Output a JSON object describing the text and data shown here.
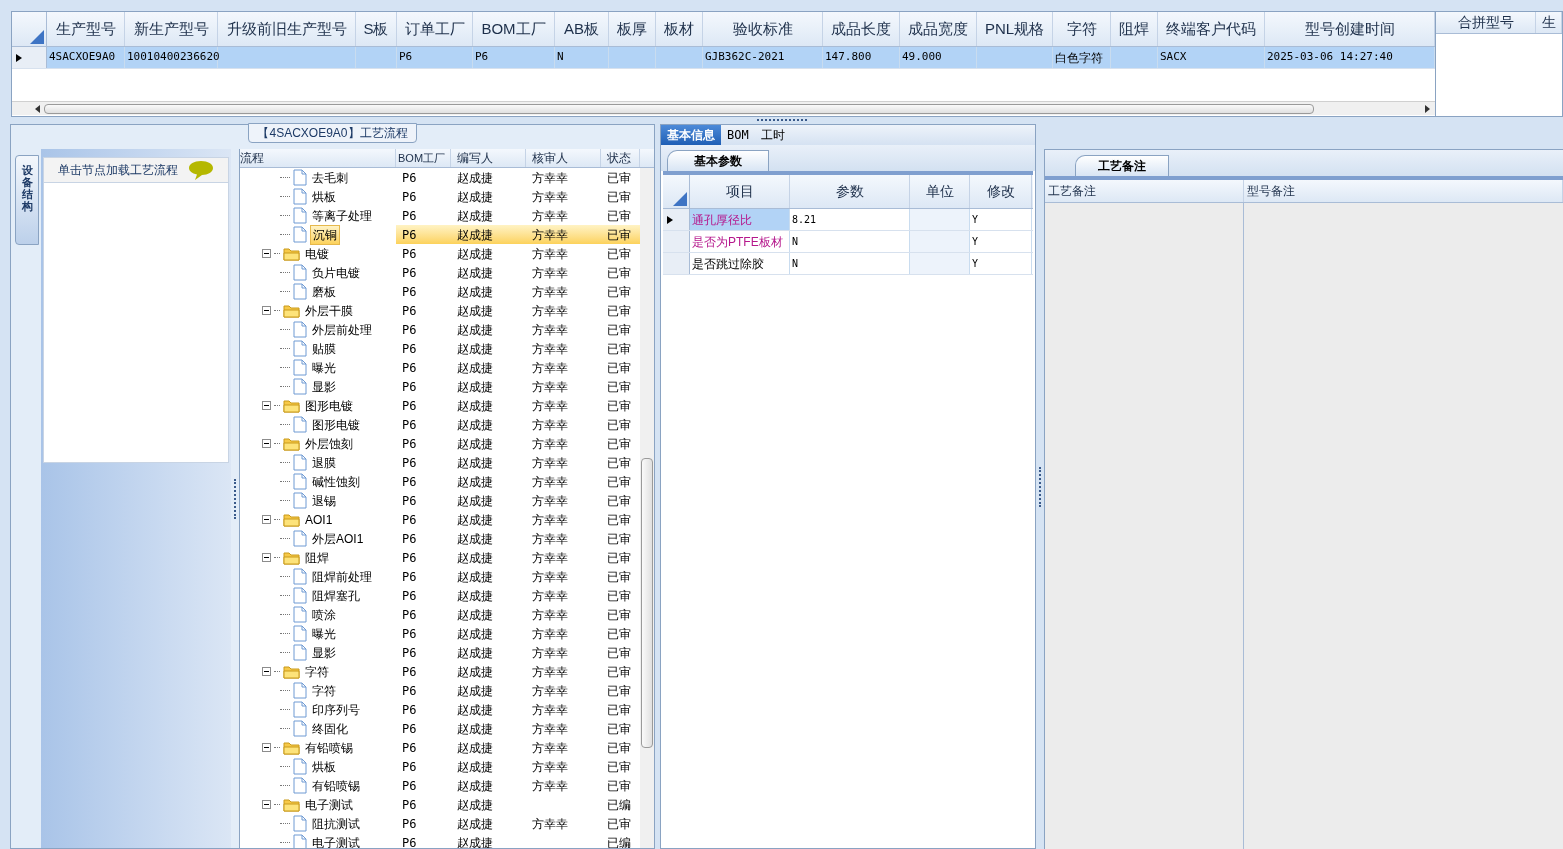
{
  "main_grid": {
    "columns": [
      "生产型号",
      "新生产型号",
      "升级前旧生产型号",
      "S板",
      "订单工厂",
      "BOM工厂",
      "AB板",
      "板厚",
      "板材",
      "验收标准",
      "成品长度",
      "成品宽度",
      "PNL规格",
      "字符",
      "阻焊",
      "终端客户代码",
      "型号创建时间"
    ],
    "rows": [
      {
        "selected": true,
        "cells": [
          "4SACXOE9A0",
          "10010400236620",
          "",
          "",
          "P6",
          "P6",
          "N",
          "",
          "",
          "GJB362C-2021",
          "147.800",
          "49.000",
          "",
          "白色字符",
          "",
          "SACX",
          "2025-03-06 14:27:40"
        ]
      }
    ]
  },
  "merge_grid": {
    "columns": [
      "合拼型号",
      "生"
    ]
  },
  "process_panel": {
    "title": "【4SACXOE9A0】工艺流程",
    "side_tab": "设备结构",
    "hint": "单击节点加载工艺流程",
    "tree_columns": [
      "流程",
      "BOM工厂",
      "编写人",
      "核审人",
      "状态"
    ],
    "tree": [
      {
        "children": [
          {
            "label": "去毛刺",
            "bom": "P6",
            "writer": "赵成捷",
            "reviewer": "方幸幸",
            "status": "已审",
            "selected": false
          },
          {
            "label": "烘板",
            "bom": "P6",
            "writer": "赵成捷",
            "reviewer": "方幸幸",
            "status": "已审",
            "selected": false
          },
          {
            "label": "等离子处理",
            "bom": "P6",
            "writer": "赵成捷",
            "reviewer": "方幸幸",
            "status": "已审",
            "selected": false
          },
          {
            "label": "沉铜",
            "bom": "P6",
            "writer": "赵成捷",
            "reviewer": "方幸幸",
            "status": "已审",
            "selected": true
          }
        ]
      },
      {
        "label": "电镀",
        "bom": "P6",
        "writer": "赵成捷",
        "reviewer": "方幸幸",
        "status": "已审",
        "selected": false,
        "expanded": true,
        "children": [
          {
            "label": "负片电镀",
            "bom": "P6",
            "writer": "赵成捷",
            "reviewer": "方幸幸",
            "status": "已审",
            "selected": false
          },
          {
            "label": "磨板",
            "bom": "P6",
            "writer": "赵成捷",
            "reviewer": "方幸幸",
            "status": "已审",
            "selected": false
          }
        ]
      },
      {
        "label": "外层干膜",
        "bom": "P6",
        "writer": "赵成捷",
        "reviewer": "方幸幸",
        "status": "已审",
        "selected": false,
        "expanded": true,
        "children": [
          {
            "label": "外层前处理",
            "bom": "P6",
            "writer": "赵成捷",
            "reviewer": "方幸幸",
            "status": "已审",
            "selected": false
          },
          {
            "label": "贴膜",
            "bom": "P6",
            "writer": "赵成捷",
            "reviewer": "方幸幸",
            "status": "已审",
            "selected": false
          },
          {
            "label": "曝光",
            "bom": "P6",
            "writer": "赵成捷",
            "reviewer": "方幸幸",
            "status": "已审",
            "selected": false
          },
          {
            "label": "显影",
            "bom": "P6",
            "writer": "赵成捷",
            "reviewer": "方幸幸",
            "status": "已审",
            "selected": false
          }
        ]
      },
      {
        "label": "图形电镀",
        "bom": "P6",
        "writer": "赵成捷",
        "reviewer": "方幸幸",
        "status": "已审",
        "selected": false,
        "expanded": true,
        "children": [
          {
            "label": "图形电镀",
            "bom": "P6",
            "writer": "赵成捷",
            "reviewer": "方幸幸",
            "status": "已审",
            "selected": false
          }
        ]
      },
      {
        "label": "外层蚀刻",
        "bom": "P6",
        "writer": "赵成捷",
        "reviewer": "方幸幸",
        "status": "已审",
        "selected": false,
        "expanded": true,
        "children": [
          {
            "label": "退膜",
            "bom": "P6",
            "writer": "赵成捷",
            "reviewer": "方幸幸",
            "status": "已审",
            "selected": false
          },
          {
            "label": "碱性蚀刻",
            "bom": "P6",
            "writer": "赵成捷",
            "reviewer": "方幸幸",
            "status": "已审",
            "selected": false
          },
          {
            "label": "退锡",
            "bom": "P6",
            "writer": "赵成捷",
            "reviewer": "方幸幸",
            "status": "已审",
            "selected": false
          }
        ]
      },
      {
        "label": "AOI1",
        "bom": "P6",
        "writer": "赵成捷",
        "reviewer": "方幸幸",
        "status": "已审",
        "selected": false,
        "expanded": true,
        "children": [
          {
            "label": "外层AOI1",
            "bom": "P6",
            "writer": "赵成捷",
            "reviewer": "方幸幸",
            "status": "已审",
            "selected": false
          }
        ]
      },
      {
        "label": "阻焊",
        "bom": "P6",
        "writer": "赵成捷",
        "reviewer": "方幸幸",
        "status": "已审",
        "selected": false,
        "expanded": true,
        "children": [
          {
            "label": "阻焊前处理",
            "bom": "P6",
            "writer": "赵成捷",
            "reviewer": "方幸幸",
            "status": "已审",
            "selected": false
          },
          {
            "label": "阻焊塞孔",
            "bom": "P6",
            "writer": "赵成捷",
            "reviewer": "方幸幸",
            "status": "已审",
            "selected": false
          },
          {
            "label": "喷涂",
            "bom": "P6",
            "writer": "赵成捷",
            "reviewer": "方幸幸",
            "status": "已审",
            "selected": false
          },
          {
            "label": "曝光",
            "bom": "P6",
            "writer": "赵成捷",
            "reviewer": "方幸幸",
            "status": "已审",
            "selected": false
          },
          {
            "label": "显影",
            "bom": "P6",
            "writer": "赵成捷",
            "reviewer": "方幸幸",
            "status": "已审",
            "selected": false
          }
        ]
      },
      {
        "label": "字符",
        "bom": "P6",
        "writer": "赵成捷",
        "reviewer": "方幸幸",
        "status": "已审",
        "selected": false,
        "expanded": true,
        "children": [
          {
            "label": "字符",
            "bom": "P6",
            "writer": "赵成捷",
            "reviewer": "方幸幸",
            "status": "已审",
            "selected": false
          },
          {
            "label": "印序列号",
            "bom": "P6",
            "writer": "赵成捷",
            "reviewer": "方幸幸",
            "status": "已审",
            "selected": false
          },
          {
            "label": "终固化",
            "bom": "P6",
            "writer": "赵成捷",
            "reviewer": "方幸幸",
            "status": "已审",
            "selected": false
          }
        ]
      },
      {
        "label": "有铅喷锡",
        "bom": "P6",
        "writer": "赵成捷",
        "reviewer": "方幸幸",
        "status": "已审",
        "selected": false,
        "expanded": true,
        "children": [
          {
            "label": "烘板",
            "bom": "P6",
            "writer": "赵成捷",
            "reviewer": "方幸幸",
            "status": "已审",
            "selected": false
          },
          {
            "label": "有铅喷锡",
            "bom": "P6",
            "writer": "赵成捷",
            "reviewer": "方幸幸",
            "status": "已审",
            "selected": false
          }
        ]
      },
      {
        "label": "电子测试",
        "bom": "P6",
        "writer": "赵成捷",
        "status": "已编",
        "selected": false,
        "expanded": true,
        "children": [
          {
            "label": "阻抗测试",
            "bom": "P6",
            "writer": "赵成捷",
            "reviewer": "方幸幸",
            "status": "已审",
            "selected": false
          },
          {
            "label": "电子测试",
            "bom": "P6",
            "writer": "赵成捷",
            "status": "已编",
            "selected": false
          }
        ]
      }
    ]
  },
  "info_panel": {
    "tabs": [
      {
        "label": "基本信息",
        "selected": true
      },
      {
        "label": "BOM",
        "selected": false
      },
      {
        "label": "工时",
        "selected": false
      }
    ],
    "sub_tab": "基本参数",
    "columns": [
      "项目",
      "参数",
      "单位",
      "修改"
    ],
    "rows": [
      {
        "item": "通孔厚径比",
        "value": "8.21",
        "unit": "",
        "modified": "Y",
        "highlighted": true,
        "selected": true
      },
      {
        "item": "是否为PTFE板材",
        "value": "N",
        "unit": "",
        "modified": "Y",
        "highlighted": true,
        "selected": false
      },
      {
        "item": "是否跳过除胶",
        "value": "N",
        "unit": "",
        "modified": "Y",
        "highlighted": false,
        "selected": false
      }
    ]
  },
  "notes_panel": {
    "tab": "工艺备注",
    "columns": [
      "工艺备注",
      "型号备注"
    ]
  }
}
